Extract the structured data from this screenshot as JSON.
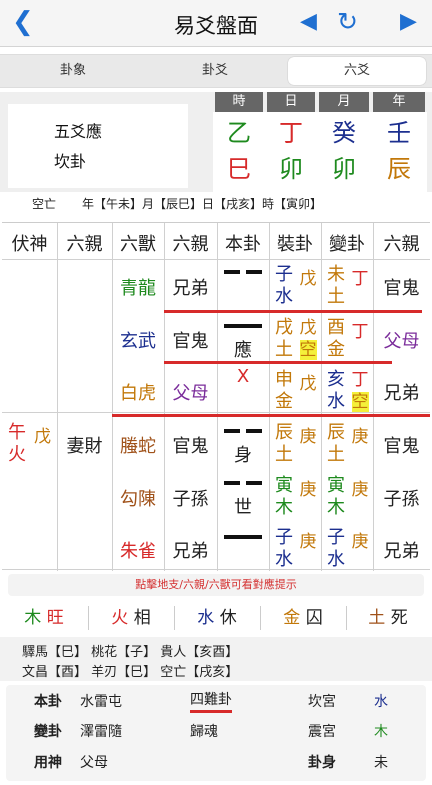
{
  "nav": {
    "title": "易爻盤面"
  },
  "tabs": [
    {
      "label": "卦象"
    },
    {
      "label": "卦爻"
    },
    {
      "label": "六爻"
    }
  ],
  "header": {
    "line1": "五爻應",
    "line2": "坎卦",
    "time_labels": [
      "時",
      "日",
      "月",
      "年"
    ],
    "stems": [
      "乙",
      "丁",
      "癸",
      "壬"
    ],
    "branches": [
      "巳",
      "卯",
      "卯",
      "辰"
    ]
  },
  "kongwang": {
    "label": "空亡",
    "text": "年【午未】月【辰巳】日【戌亥】時【寅卯】"
  },
  "table": {
    "headers": [
      "伏神",
      "六親",
      "六獸",
      "六親",
      "本卦",
      "裝卦",
      "變卦",
      "六親"
    ],
    "fushen": {
      "shen": "午火",
      "stem": "戊",
      "liuqin": "妻財"
    },
    "rows": [
      {
        "beast": "青龍",
        "qin1": "兄弟",
        "mark": "",
        "zhuang_b": "子",
        "zhuang_e": "水",
        "zhuang_s": "戊",
        "bian_b": "未",
        "bian_e": "土",
        "bian_s": "丁",
        "qin2": "官鬼"
      },
      {
        "beast": "玄武",
        "qin1": "官鬼",
        "mark": "應",
        "zhuang_b": "戌",
        "zhuang_e": "土",
        "zhuang_s": "戊",
        "zhuang_k": "空",
        "bian_b": "酉",
        "bian_e": "金",
        "bian_s": "丁",
        "qin2": "父母"
      },
      {
        "beast": "白虎",
        "qin1": "父母",
        "mark": "X",
        "zhuang_b": "申",
        "zhuang_e": "金",
        "zhuang_s": "戊",
        "bian_b": "亥",
        "bian_e": "水",
        "bian_s": "丁",
        "bian_k": "空",
        "qin2": "兄弟"
      },
      {
        "beast": "螣蛇",
        "qin1": "官鬼",
        "mark": "身",
        "zhuang_b": "辰",
        "zhuang_e": "土",
        "zhuang_s": "庚",
        "bian_b": "辰",
        "bian_e": "土",
        "bian_s": "庚",
        "qin2": "官鬼"
      },
      {
        "beast": "勾陳",
        "qin1": "子孫",
        "mark": "世",
        "zhuang_b": "寅",
        "zhuang_e": "木",
        "zhuang_s": "庚",
        "bian_b": "寅",
        "bian_e": "木",
        "bian_s": "庚",
        "qin2": "子孫"
      },
      {
        "beast": "朱雀",
        "qin1": "兄弟",
        "mark": "",
        "zhuang_b": "子",
        "zhuang_e": "水",
        "zhuang_s": "庚",
        "bian_b": "子",
        "bian_e": "水",
        "bian_s": "庚",
        "qin2": "兄弟"
      }
    ]
  },
  "hint": "點擊地支/六親/六獸可看對應提示",
  "wuxing": [
    {
      "el": "木",
      "st": "旺"
    },
    {
      "el": "火",
      "st": "相"
    },
    {
      "el": "水",
      "st": "休"
    },
    {
      "el": "金",
      "st": "囚"
    },
    {
      "el": "土",
      "st": "死"
    }
  ],
  "shensha": {
    "line1": "驛馬【巳】 桃花【子】 貴人【亥酉】",
    "line2": "文昌【酉】 羊刃【巳】 空亡【戌亥】"
  },
  "bottom": [
    {
      "k": "本卦",
      "v": "水雷屯",
      "c": "四難卦",
      "p": "坎宮",
      "e": "水"
    },
    {
      "k": "變卦",
      "v": "澤雷隨",
      "c": "歸魂",
      "p": "震宮",
      "e": "木"
    },
    {
      "k": "用神",
      "v": "父母",
      "c": "",
      "p": "卦身",
      "e": "未"
    }
  ],
  "colors": {
    "accent": "#1f6fd1",
    "red": "#d72a2a",
    "green": "#1e8a1e",
    "purple": "#7b2d9b",
    "orange": "#c2780a",
    "navy": "#1c2f8f",
    "brown": "#a0521a"
  }
}
